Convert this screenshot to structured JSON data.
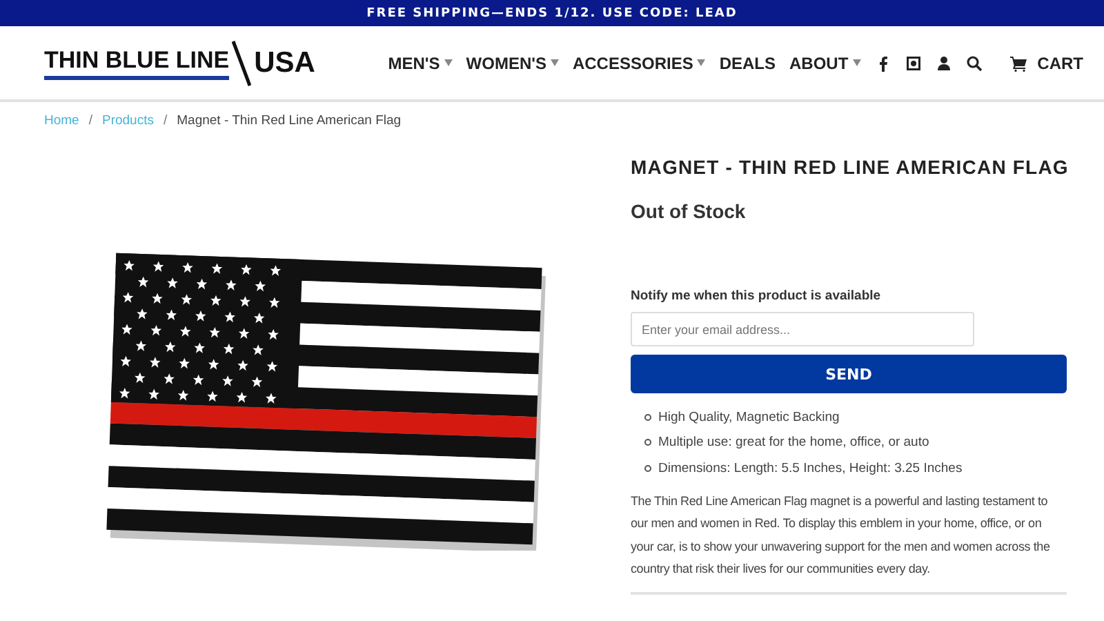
{
  "promo_bar": {
    "text": "FREE SHIPPING—ENDS 1/12. USE CODE: LEAD"
  },
  "logo": {
    "text": "THIN BLUE LINE",
    "suffix": "USA"
  },
  "nav": [
    {
      "label": "MEN'S",
      "has_dropdown": true
    },
    {
      "label": "WOMEN'S",
      "has_dropdown": true
    },
    {
      "label": "ACCESSORIES",
      "has_dropdown": true
    },
    {
      "label": "DEALS",
      "has_dropdown": false
    },
    {
      "label": "ABOUT",
      "has_dropdown": true
    }
  ],
  "cart": {
    "label": "CART"
  },
  "breadcrumb": [
    {
      "label": "Home",
      "kind": "link"
    },
    {
      "label": "/",
      "kind": "separator"
    },
    {
      "label": "Products",
      "kind": "link"
    },
    {
      "label": "/",
      "kind": "separator"
    },
    {
      "label": "Magnet - Thin Red Line American Flag",
      "kind": "current"
    }
  ],
  "product": {
    "title": "MAGNET - THIN RED LINE AMERICAN FLAG",
    "stock": "Out of Stock",
    "notify_label": "Notify me when this product is available",
    "email": {
      "placeholder": "Enter your email address..."
    },
    "send_button": "SEND",
    "features": [
      "High Quality, Magnetic Backing",
      "Multiple use: great for the home, office, or auto",
      "Dimensions: Length: 5.5 Inches, Height: 3.25 Inches"
    ],
    "description": "The Thin Red Line American Flag magnet is a powerful and lasting testament to our men and women in Red. To display this emblem in your home, office, or on your car, is to show your unwavering support for the men and women across the country that risk their lives for our communities every day."
  }
}
